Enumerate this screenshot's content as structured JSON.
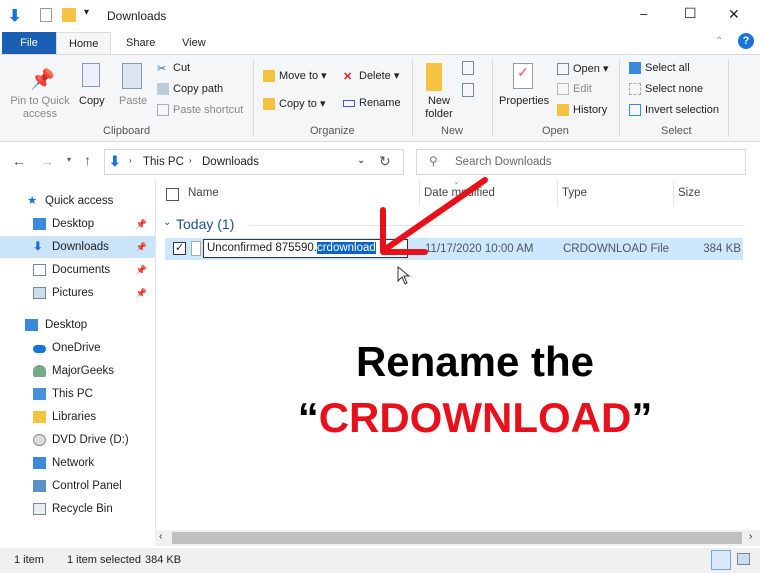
{
  "window": {
    "title": "Downloads",
    "minimize": "–",
    "maximize": "☐",
    "close": "✕"
  },
  "tabs": [
    {
      "label": "File"
    },
    {
      "label": "Home"
    },
    {
      "label": "Share"
    },
    {
      "label": "View"
    }
  ],
  "help": "?",
  "ribbon": {
    "clipboard": {
      "label": "Clipboard",
      "pin": "Pin to Quick access",
      "copy": "Copy",
      "paste": "Paste",
      "cut": "Cut",
      "copy_path": "Copy path",
      "paste_shortcut": "Paste shortcut"
    },
    "organize": {
      "label": "Organize",
      "move_to": "Move to ▾",
      "copy_to": "Copy to ▾",
      "delete": "Delete ▾",
      "rename": "Rename"
    },
    "new": {
      "label": "New",
      "new_folder": "New folder"
    },
    "open": {
      "label": "Open",
      "properties": "Properties",
      "open": "Open ▾",
      "edit": "Edit",
      "history": "History"
    },
    "select": {
      "label": "Select",
      "select_all": "Select all",
      "select_none": "Select none",
      "invert": "Invert selection"
    }
  },
  "address": {
    "this_pc": "This PC",
    "downloads": "Downloads",
    "search_placeholder": "Search Downloads"
  },
  "sidebar": {
    "items": [
      {
        "label": "Quick access"
      },
      {
        "label": "Desktop"
      },
      {
        "label": "Downloads"
      },
      {
        "label": "Documents"
      },
      {
        "label": "Pictures"
      },
      {
        "label": "Desktop"
      },
      {
        "label": "OneDrive"
      },
      {
        "label": "MajorGeeks"
      },
      {
        "label": "This PC"
      },
      {
        "label": "Libraries"
      },
      {
        "label": "DVD Drive (D:)"
      },
      {
        "label": "Network"
      },
      {
        "label": "Control Panel"
      },
      {
        "label": "Recycle Bin"
      }
    ]
  },
  "columns": {
    "name": "Name",
    "date": "Date modified",
    "type": "Type",
    "size": "Size"
  },
  "group": {
    "label": "Today (1)"
  },
  "file": {
    "name_base": "Unconfirmed 875590.",
    "name_ext": "crdownload",
    "date": "11/17/2020 10:00 AM",
    "type": "CRDOWNLOAD File",
    "size": "384 KB"
  },
  "overlay": {
    "line1": "Rename the",
    "quote_open": "“",
    "highlight": "CRDOWNLOAD",
    "quote_close": "”",
    "highlight_color": "#e8101a"
  },
  "status": {
    "count": "1 item",
    "selected": "1 item selected",
    "size": "384 KB"
  }
}
